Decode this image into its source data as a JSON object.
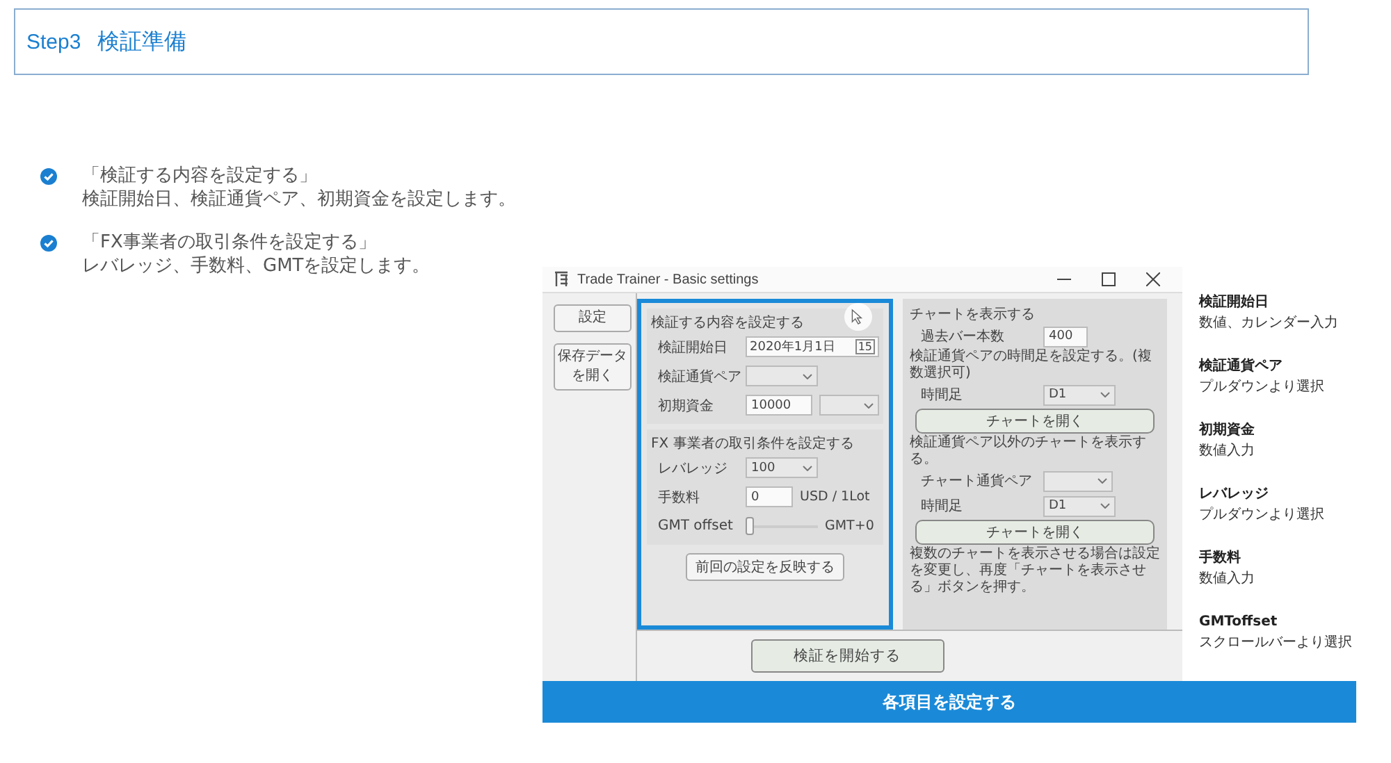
{
  "header": {
    "step": "Step3",
    "title": "検証準備"
  },
  "bullets": [
    {
      "title": "「検証する内容を設定する」",
      "text": "検証開始日、検証通貨ペア、初期資金を設定します。"
    },
    {
      "title": "「FX事業者の取引条件を設定する」",
      "text": "レバレッジ、手数料、GMTを設定します。"
    }
  ],
  "window": {
    "title": "Trade Trainer - Basic settings",
    "side_buttons": [
      "設定",
      "保存データを開く"
    ],
    "left_panel": {
      "highlighted": true,
      "sections": [
        {
          "heading": "検証する内容を設定する",
          "rows": [
            {
              "kind": "date",
              "label": "検証開始日",
              "value": "2020年1月1日",
              "calendar_day": "15"
            },
            {
              "kind": "select",
              "label": "検証通貨ペア"
            },
            {
              "kind": "input_select",
              "label": "初期資金",
              "value": "10000"
            }
          ]
        },
        {
          "heading": "FX 事業者の取引条件を設定する",
          "rows": [
            {
              "kind": "select",
              "label": "レバレッジ",
              "value": "100"
            },
            {
              "kind": "input",
              "label": "手数料",
              "value": "0",
              "unit": "USD / 1Lot"
            },
            {
              "kind": "slider",
              "label": "GMT offset",
              "level": 0,
              "reading": "GMT+0"
            }
          ]
        }
      ],
      "button": "前回の設定を反映する"
    },
    "right_panel": {
      "items": [
        {
          "kind": "heading",
          "text": "チャートを表示する"
        },
        {
          "kind": "input",
          "label": "過去バー本数",
          "value": "400"
        },
        {
          "kind": "heading",
          "text": "検証通貨ペアの時間足を設定する。(複数選択可)"
        },
        {
          "kind": "select",
          "label": "時間足",
          "value": "D1"
        },
        {
          "kind": "button",
          "text": "チャートを開く"
        },
        {
          "kind": "heading",
          "text": "検証通貨ペア以外のチャートを表示する。"
        },
        {
          "kind": "select",
          "label": "チャート通貨ペア"
        },
        {
          "kind": "select",
          "label": "時間足",
          "value": "D1"
        },
        {
          "kind": "button",
          "text": "チャートを開く"
        },
        {
          "kind": "heading",
          "text": "複数のチャートを表示させる場合は設定を変更し、再度「チャートを表示させる」ボタンを押す。"
        }
      ]
    },
    "start_button": "検証を開始する"
  },
  "legend": [
    {
      "title": "検証開始日",
      "text": "数値、カレンダー入力"
    },
    {
      "title": "検証通貨ペア",
      "text": "プルダウンより選択"
    },
    {
      "title": "初期資金",
      "text": "数値入力"
    },
    {
      "title": "レバレッジ",
      "text": "プルダウンより選択"
    },
    {
      "title": "手数料",
      "text": "数値入力"
    },
    {
      "title": "GMToffset",
      "text": "スクロールバーより選択"
    }
  ],
  "banner": "各項目を設定する"
}
